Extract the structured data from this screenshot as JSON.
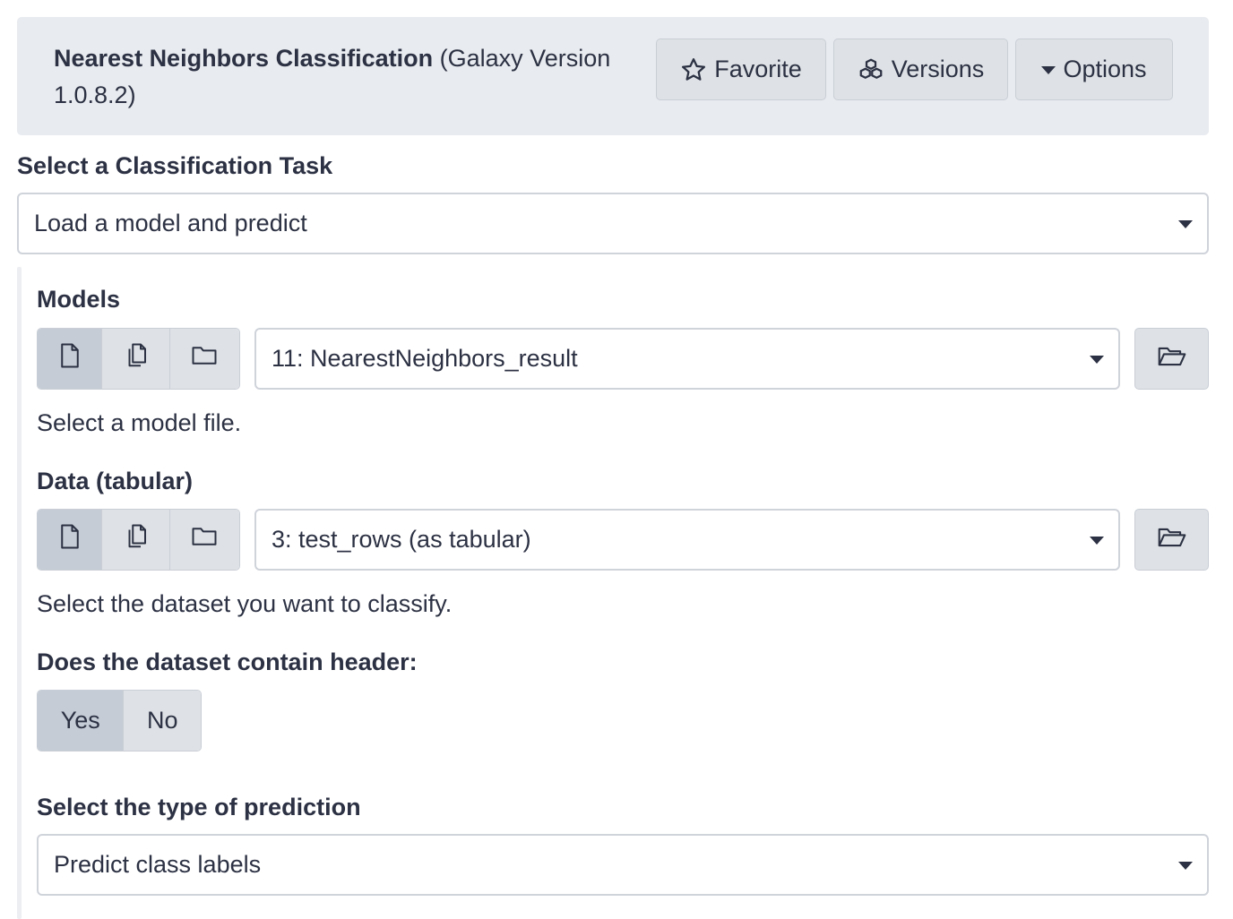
{
  "header": {
    "tool_name": "Nearest Neighbors Classification",
    "version_text": "(Galaxy Version 1.0.8.2)",
    "favorite_label": "Favorite",
    "versions_label": "Versions",
    "options_label": "Options"
  },
  "classification_task": {
    "label": "Select a Classification Task",
    "selected": "Load a model and predict"
  },
  "models": {
    "label": "Models",
    "selected": "11: NearestNeighbors_result",
    "help": "Select a model file."
  },
  "data": {
    "label": "Data (tabular)",
    "selected": "3: test_rows (as tabular)",
    "help": "Select the dataset you want to classify."
  },
  "header_option": {
    "label": "Does the dataset contain header:",
    "yes_label": "Yes",
    "no_label": "No",
    "selected": "Yes"
  },
  "prediction_type": {
    "label": "Select the type of prediction",
    "selected": "Predict class labels"
  },
  "icons": {
    "favorite": "star-icon",
    "versions": "cubes-icon",
    "options": "caret-down-icon",
    "single_dataset": "file-icon",
    "multiple_datasets": "files-icon",
    "collection": "folder-icon",
    "browse": "folder-open-icon"
  }
}
